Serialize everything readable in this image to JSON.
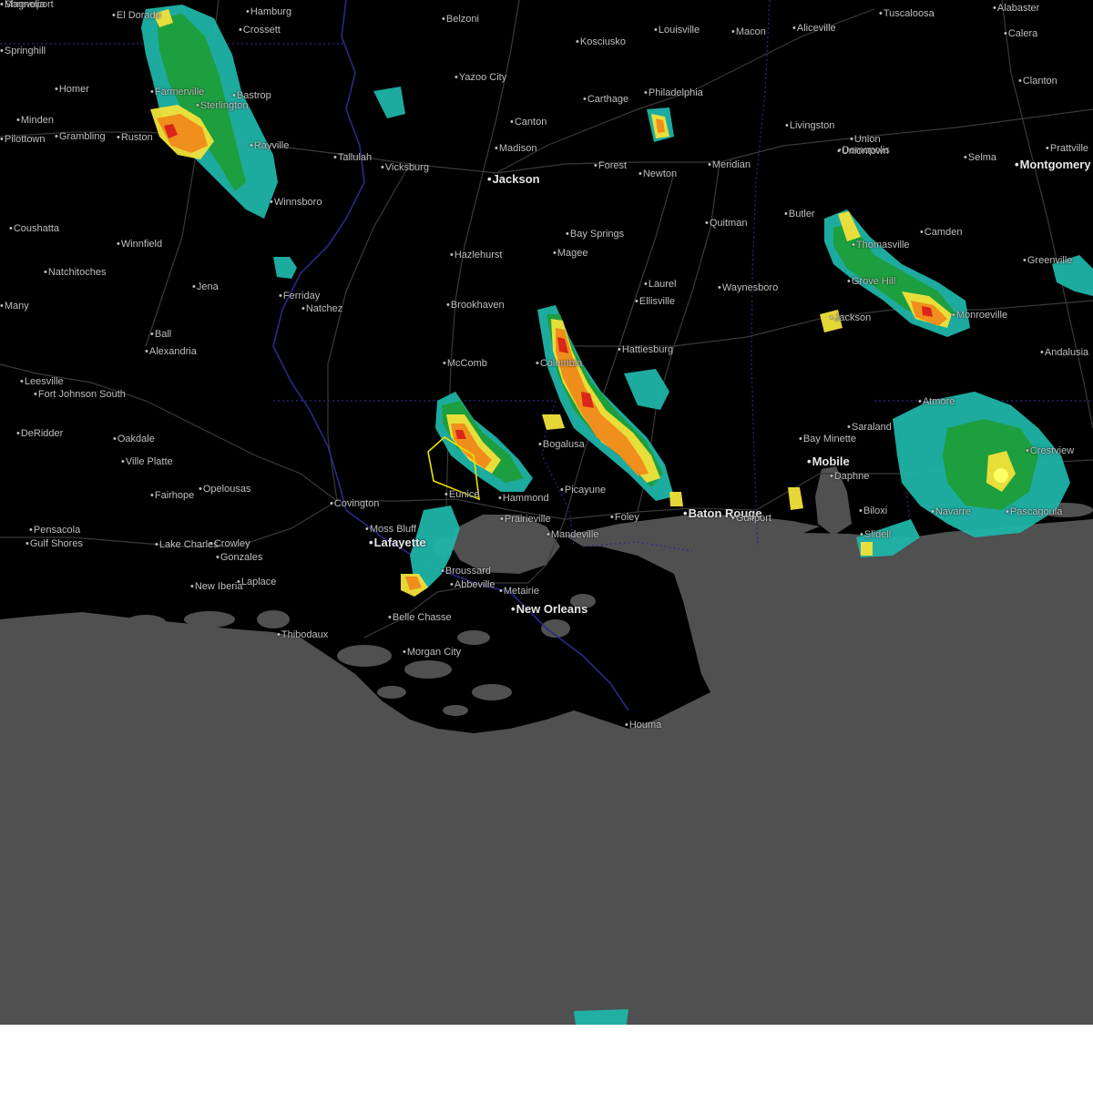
{
  "map": {
    "colors": {
      "land": "#000000",
      "water": "#505050",
      "page_background": "#ffffff",
      "state_border": "#2a2a8a",
      "roads": "#3a3a3a",
      "warning_polygon": "#f0e000",
      "radar_light": "#1fb4a8",
      "radar_moderate": "#1e9e3a",
      "radar_heavy": "#f2e23a",
      "radar_severe": "#f08a1a",
      "radar_extreme": "#d8201a"
    },
    "warning_polygon_color_name": "yellow",
    "cities": [
      {
        "name": "El Dorado",
        "major": false
      },
      {
        "name": "Hamburg",
        "major": false
      },
      {
        "name": "Belzoni",
        "major": false
      },
      {
        "name": "Louisville",
        "major": false
      },
      {
        "name": "Macon",
        "major": false
      },
      {
        "name": "Aliceville",
        "major": false
      },
      {
        "name": "Tuscaloosa",
        "major": false
      },
      {
        "name": "Alabaster",
        "major": false
      },
      {
        "name": "Springhill",
        "major": false
      },
      {
        "name": "Crossett",
        "major": false
      },
      {
        "name": "Kosciusko",
        "major": false
      },
      {
        "name": "Calera",
        "major": false
      },
      {
        "name": "Yazoo City",
        "major": false
      },
      {
        "name": "Clanton",
        "major": false
      },
      {
        "name": "Homer",
        "major": false
      },
      {
        "name": "Farmerville",
        "major": false
      },
      {
        "name": "Bastrop",
        "major": false
      },
      {
        "name": "Carthage",
        "major": false
      },
      {
        "name": "Philadelphia",
        "major": false
      },
      {
        "name": "Minden",
        "major": false
      },
      {
        "name": "Sterlington",
        "major": false
      },
      {
        "name": "Canton",
        "major": false
      },
      {
        "name": "Livingston",
        "major": false
      },
      {
        "name": "Grambling",
        "major": false
      },
      {
        "name": "Ruston",
        "major": false
      },
      {
        "name": "Rayville",
        "major": false
      },
      {
        "name": "Madison",
        "major": false
      },
      {
        "name": "Union",
        "major": false
      },
      {
        "name": "Demopolis",
        "major": false
      },
      {
        "name": "Prattville",
        "major": false
      },
      {
        "name": "Uniontown",
        "major": false
      },
      {
        "name": "Tallulah",
        "major": false
      },
      {
        "name": "Vicksburg",
        "major": false
      },
      {
        "name": "Forest",
        "major": false
      },
      {
        "name": "Meridian",
        "major": false
      },
      {
        "name": "Selma",
        "major": false
      },
      {
        "name": "Montgomery",
        "major": true
      },
      {
        "name": "Jackson",
        "major": true
      },
      {
        "name": "Newton",
        "major": false
      },
      {
        "name": "Winnsboro",
        "major": false
      },
      {
        "name": "Coushatta",
        "major": false
      },
      {
        "name": "Butler",
        "major": false
      },
      {
        "name": "Quitman",
        "major": false
      },
      {
        "name": "Bay Springs",
        "major": false
      },
      {
        "name": "Camden",
        "major": false
      },
      {
        "name": "Winnfield",
        "major": false
      },
      {
        "name": "Thomasville",
        "major": false
      },
      {
        "name": "Hazlehurst",
        "major": false
      },
      {
        "name": "Magee",
        "major": false
      },
      {
        "name": "Greenville",
        "major": false
      },
      {
        "name": "Natchitoches",
        "major": false
      },
      {
        "name": "Ferriday",
        "major": false
      },
      {
        "name": "Grove Hill",
        "major": false
      },
      {
        "name": "Jena",
        "major": false
      },
      {
        "name": "Laurel",
        "major": false
      },
      {
        "name": "Waynesboro",
        "major": false
      },
      {
        "name": "Ellisville",
        "major": false
      },
      {
        "name": "Brookhaven",
        "major": false
      },
      {
        "name": "Natchez",
        "major": false
      },
      {
        "name": "Many",
        "major": false
      },
      {
        "name": "Jackson",
        "major": false
      },
      {
        "name": "Monroeville",
        "major": false
      },
      {
        "name": "Ball",
        "major": false
      },
      {
        "name": "Alexandria",
        "major": false
      },
      {
        "name": "Hattiesburg",
        "major": false
      },
      {
        "name": "Andalusia",
        "major": false
      },
      {
        "name": "McComb",
        "major": false
      },
      {
        "name": "Columbia",
        "major": false
      },
      {
        "name": "Leesville",
        "major": false
      },
      {
        "name": "Fort Johnson South",
        "major": false
      },
      {
        "name": "Atmore",
        "major": false
      },
      {
        "name": "DeRidder",
        "major": false
      },
      {
        "name": "Bay Minette",
        "major": false
      },
      {
        "name": "Saraland",
        "major": false
      },
      {
        "name": "Oakdale",
        "major": false
      },
      {
        "name": "Bogalusa",
        "major": false
      },
      {
        "name": "Crestview",
        "major": false
      },
      {
        "name": "Mobile",
        "major": true
      },
      {
        "name": "Ville Platte",
        "major": false
      },
      {
        "name": "Daphne",
        "major": false
      },
      {
        "name": "Opelousas",
        "major": false
      },
      {
        "name": "Picayune",
        "major": false
      },
      {
        "name": "Fairhope",
        "major": false
      },
      {
        "name": "Eunice",
        "major": false
      },
      {
        "name": "Hammond",
        "major": false
      },
      {
        "name": "Covington",
        "major": false
      },
      {
        "name": "Baton Rouge",
        "major": true
      },
      {
        "name": "Biloxi",
        "major": false
      },
      {
        "name": "Foley",
        "major": false
      },
      {
        "name": "Gulfport",
        "major": false
      },
      {
        "name": "Pascagoula",
        "major": false
      },
      {
        "name": "Navarre",
        "major": false
      },
      {
        "name": "Pensacola",
        "major": false
      },
      {
        "name": "Moss Bluff",
        "major": false
      },
      {
        "name": "Prairieville",
        "major": false
      },
      {
        "name": "Mandeville",
        "major": false
      },
      {
        "name": "Slidell",
        "major": false
      },
      {
        "name": "Gulf Shores",
        "major": false
      },
      {
        "name": "Lake Charles",
        "major": false
      },
      {
        "name": "Crowley",
        "major": false
      },
      {
        "name": "Lafayette",
        "major": true
      },
      {
        "name": "Gonzales",
        "major": false
      },
      {
        "name": "Broussard",
        "major": false
      },
      {
        "name": "Laplace",
        "major": false
      },
      {
        "name": "New Iberia",
        "major": false
      },
      {
        "name": "Abbeville",
        "major": false
      },
      {
        "name": "Metairie",
        "major": false
      },
      {
        "name": "New Orleans",
        "major": true
      },
      {
        "name": "Belle Chasse",
        "major": false
      },
      {
        "name": "Thibodaux",
        "major": false
      },
      {
        "name": "Morgan City",
        "major": false
      },
      {
        "name": "Houma",
        "major": false
      },
      {
        "name": "Pilottown",
        "major": false
      },
      {
        "name": "Shreveport",
        "major": false
      },
      {
        "name": "Magnolia",
        "major": false
      }
    ]
  }
}
